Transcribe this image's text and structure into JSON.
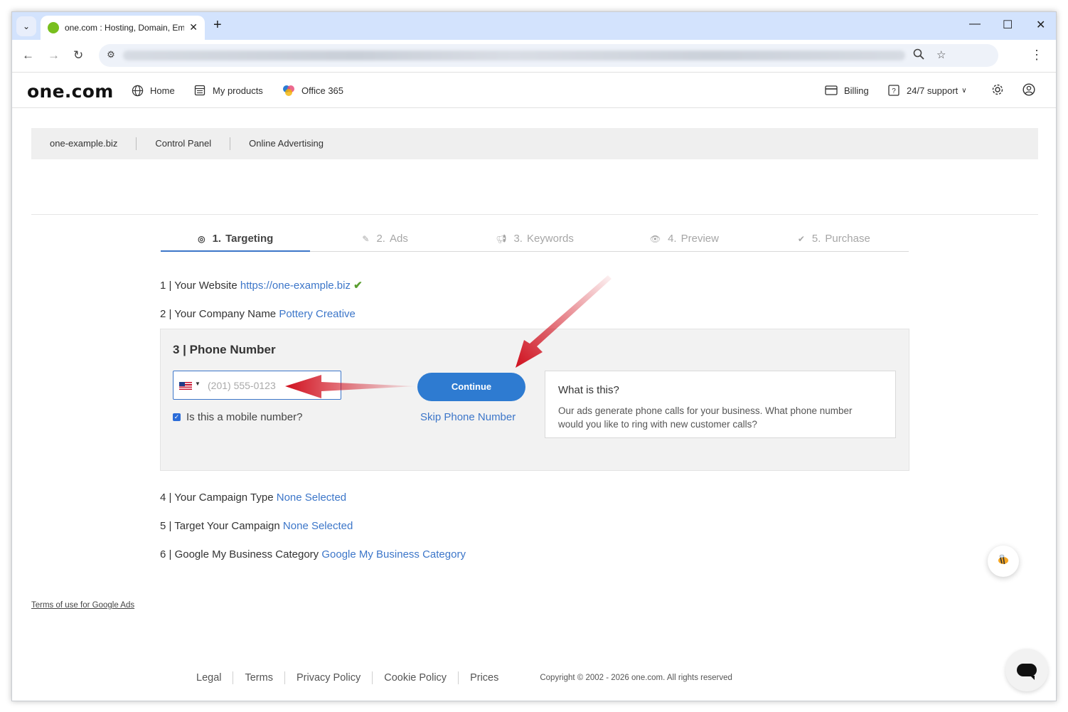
{
  "browser": {
    "tab_title": "one.com : Hosting, Domain, Em",
    "new_tab": "+",
    "min": "—",
    "max": "☐",
    "close": "✕"
  },
  "site": {
    "logo": "one.com",
    "nav": {
      "home": "Home",
      "my_products": "My products",
      "office": "Office 365",
      "billing": "Billing",
      "support": "24/7 support"
    }
  },
  "breadcrumbs": [
    "one-example.biz",
    "Control Panel",
    "Online Advertising"
  ],
  "steps": [
    {
      "num": "1.",
      "label": "Targeting",
      "icon": "target-icon"
    },
    {
      "num": "2.",
      "label": "Ads",
      "icon": "pencil-icon"
    },
    {
      "num": "3.",
      "label": "Keywords",
      "icon": "megaphone-icon"
    },
    {
      "num": "4.",
      "label": "Preview",
      "icon": "eye-icon"
    },
    {
      "num": "5.",
      "label": "Purchase",
      "icon": "check-circle-icon"
    }
  ],
  "form": {
    "website_label": "1 | Your Website",
    "website_value": "https://one-example.biz",
    "company_label": "2 | Your Company Name",
    "company_value": "Pottery Creative",
    "phone_title": "3 | Phone Number",
    "phone_placeholder": "(201) 555-0123",
    "mobile_label": "Is this a mobile number?",
    "continue": "Continue",
    "skip": "Skip Phone Number",
    "info_title": "What is this?",
    "info_body": "Our ads generate phone calls for your business. What phone number would you like to ring with new customer calls?",
    "campaign_type_label": "4 | Your Campaign Type",
    "campaign_type_value": "None Selected",
    "target_label": "5 | Target Your Campaign",
    "target_value": "None Selected",
    "gmb_label": "6 | Google My Business Category",
    "gmb_value": "Google My Business Category"
  },
  "footer": {
    "terms_google": "Terms of use for Google Ads",
    "links": [
      "Legal",
      "Terms",
      "Privacy Policy",
      "Cookie Policy",
      "Prices"
    ],
    "copyright": "Copyright © 2002 - 2026 one.com. All rights reserved"
  },
  "colors": {
    "accent": "#2e7bd1",
    "link": "#3c76c9",
    "annotation_arrow": "#d0101e"
  }
}
